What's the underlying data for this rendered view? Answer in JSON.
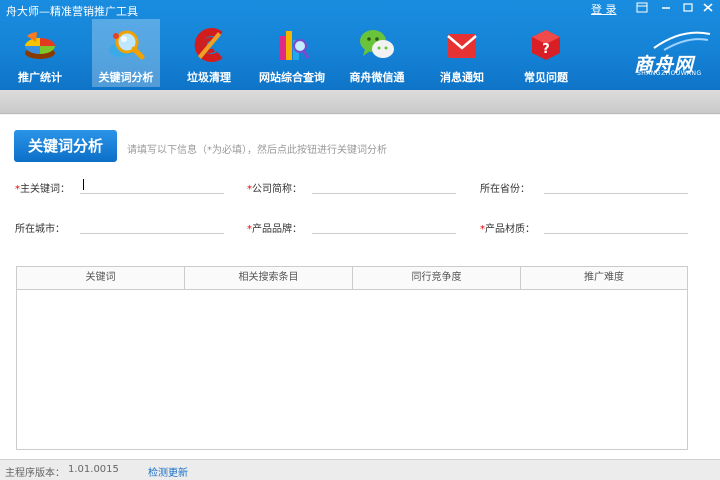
{
  "window": {
    "title": "舟大师—精准营销推广工具",
    "login": "登 录"
  },
  "nav": [
    {
      "label": "推广统计",
      "icon": "pie-chart-icon",
      "active": false
    },
    {
      "label": "关键词分析",
      "icon": "magnifier-icon",
      "active": true
    },
    {
      "label": "垃圾清理",
      "icon": "ccleaner-icon",
      "active": false
    },
    {
      "label": "网站综合查询",
      "icon": "website-query-icon",
      "active": false
    },
    {
      "label": "商舟微信通",
      "icon": "wechat-icon",
      "active": false
    },
    {
      "label": "消息通知",
      "icon": "envelope-icon",
      "active": false
    },
    {
      "label": "常见问题",
      "icon": "question-dice-icon",
      "active": false
    }
  ],
  "logo": {
    "brand": "商舟网",
    "sub": "SHANGZHOUWANG"
  },
  "analyze": {
    "button_label": "关键词分析",
    "hint": "请填写以下信息（*为必填），然后点此按钮进行关键词分析"
  },
  "form": {
    "main_keyword": {
      "label": "主关键词：",
      "required": true,
      "value": ""
    },
    "company_name": {
      "label": "公司简称：",
      "required": true,
      "value": ""
    },
    "province": {
      "label": "所在省份：",
      "required": false,
      "value": ""
    },
    "city": {
      "label": "所在城市：",
      "required": false,
      "value": ""
    },
    "brand": {
      "label": "产品品牌：",
      "required": true,
      "value": ""
    },
    "material": {
      "label": "产品材质：",
      "required": true,
      "value": ""
    }
  },
  "table": {
    "columns": [
      "关键词",
      "相关搜索条目",
      "同行竞争度",
      "推广难度"
    ],
    "rows": []
  },
  "status": {
    "version_label": "主程序版本：",
    "version_value": "1.01.0015",
    "update_link": "检测更新"
  },
  "colors": {
    "header": "#1583d6",
    "accent": "#0d6fc8",
    "required": "#e00000"
  }
}
